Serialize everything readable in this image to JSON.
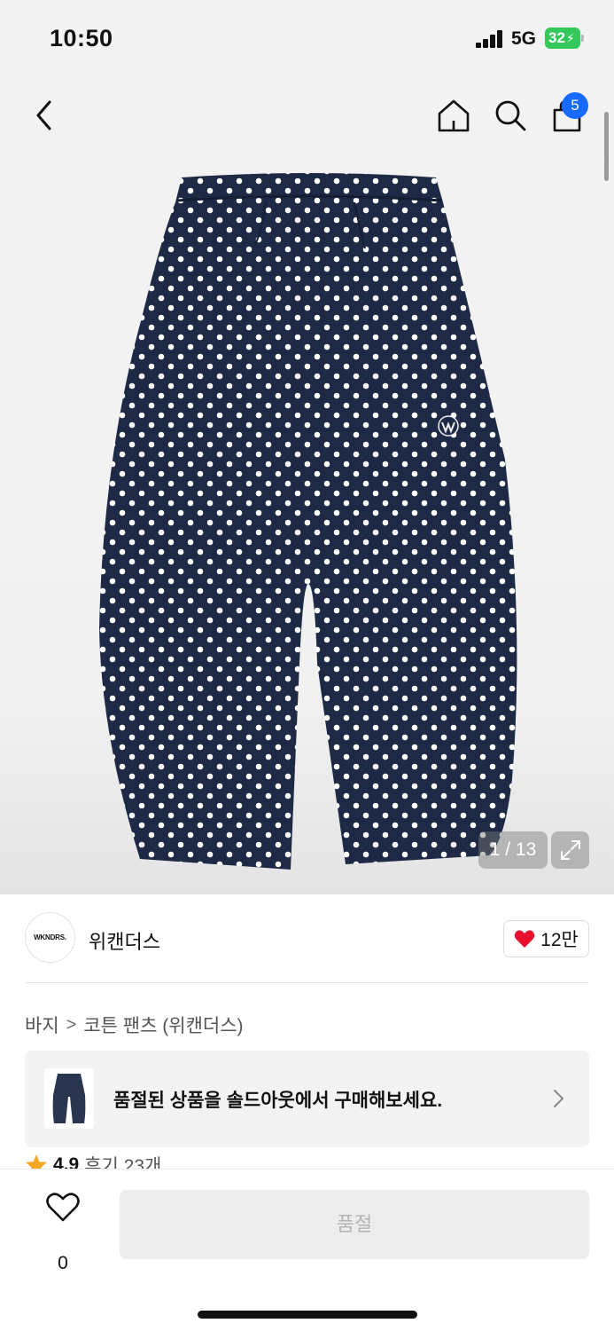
{
  "status_bar": {
    "time": "10:50",
    "network": "5G",
    "battery": "32"
  },
  "header": {
    "back_icon": "chevron-left-icon",
    "home_icon": "home-icon",
    "search_icon": "search-icon",
    "cart_icon": "shopping-bag-icon",
    "cart_badge": "5",
    "badge_color": "#1769ff"
  },
  "gallery": {
    "counter": "1 / 13",
    "expand_icon": "expand-icon",
    "product_colors": {
      "fabric": "#1e2a45",
      "dot": "#ffffff"
    }
  },
  "brand": {
    "logo_text": "WKNDRS.",
    "name": "위캔더스",
    "likes": "12만",
    "heart_color": "#e8112d"
  },
  "breadcrumb": {
    "category": "바지",
    "separator": ">",
    "product": "코튼 팬츠 (위캔더스)"
  },
  "banner": {
    "text": "품절된 상품을 솔드아웃에서 구매해보세요.",
    "chevron_icon": "chevron-right-icon"
  },
  "rating": {
    "star_color": "#f5a623",
    "score": "4.9",
    "reviews": "후기 23개"
  },
  "bottom": {
    "wish_count": "0",
    "soldout_label": "품절"
  }
}
